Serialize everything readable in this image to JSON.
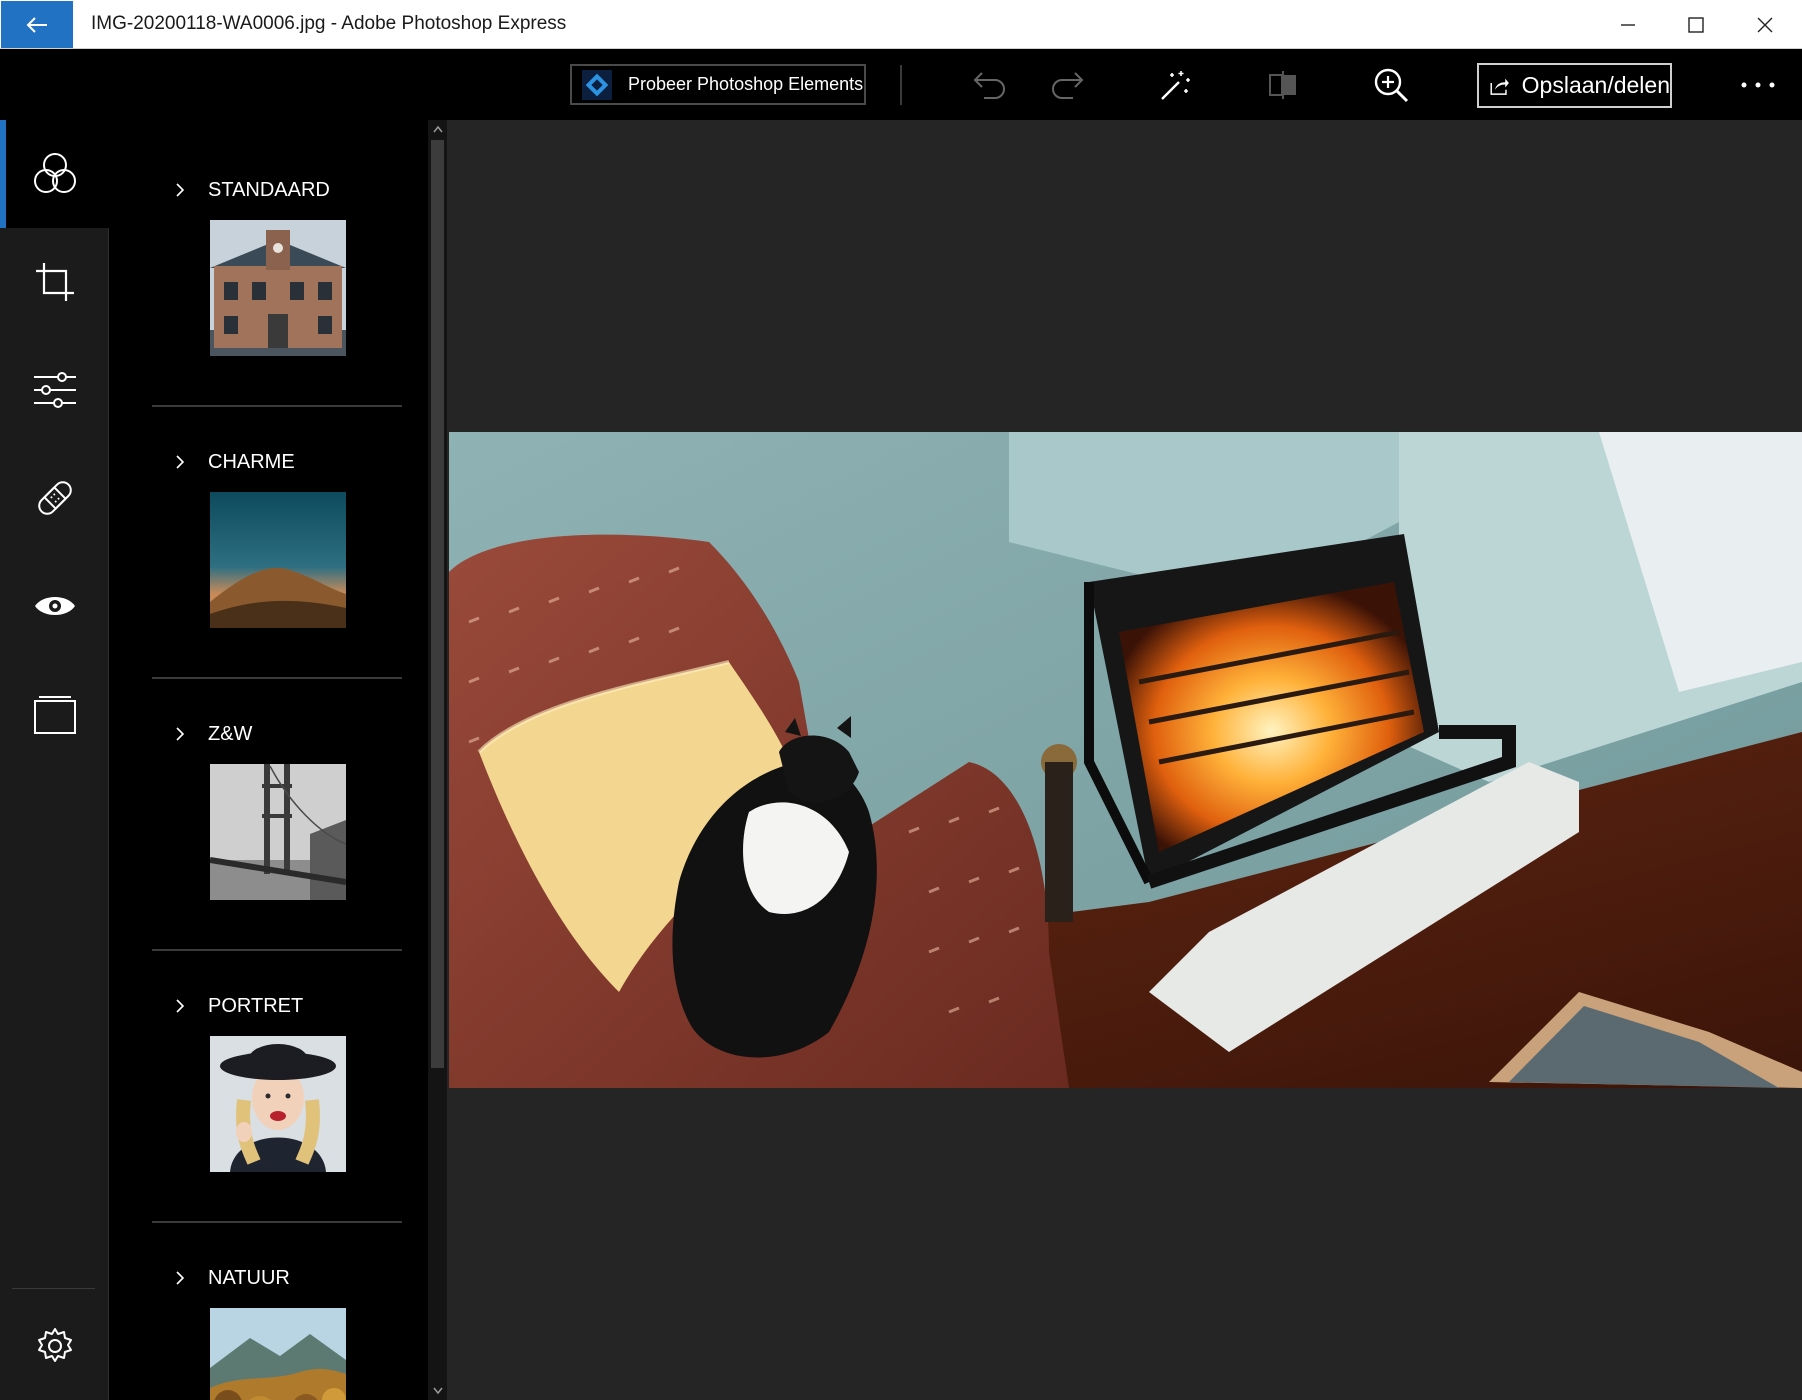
{
  "window": {
    "title": "IMG-20200118-WA0006.jpg - Adobe Photoshop Express"
  },
  "toolbar": {
    "promo_label": "Probeer Photoshop Elements",
    "save_label": "Opslaan/delen",
    "icons": [
      "undo-icon",
      "redo-icon",
      "auto-fix-icon",
      "compare-icon",
      "zoom-in-icon",
      "share-icon",
      "more-icon"
    ]
  },
  "rail": {
    "items": [
      "looks-icon",
      "crop-icon",
      "adjustments-icon",
      "healing-icon",
      "red-eye-icon",
      "borders-icon"
    ],
    "active": "looks-icon",
    "settings": "settings-icon"
  },
  "looks": {
    "categories": [
      {
        "label": "STANDAARD"
      },
      {
        "label": "CHARME"
      },
      {
        "label": "Z&W"
      },
      {
        "label": "PORTRET"
      },
      {
        "label": "NATUUR"
      }
    ]
  },
  "colors": {
    "accent": "#2272c3",
    "toolbar_bg": "#000000",
    "rail_bg": "#1b1b1b",
    "canvas_bg": "#252525"
  }
}
